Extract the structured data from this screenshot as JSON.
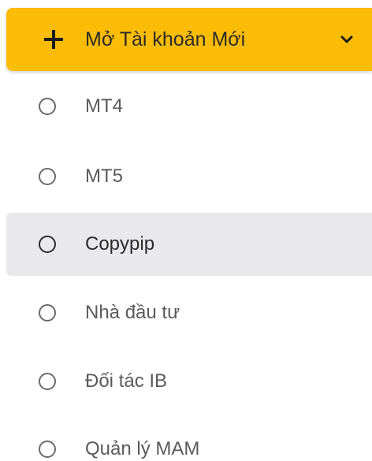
{
  "header": {
    "title": "Mở Tài khoản Mới",
    "icon": "plus-icon",
    "expand_icon": "chevron-down-icon",
    "color": "#fbbc05"
  },
  "items": [
    {
      "label": "MT4",
      "icon": "radio-icon",
      "active": false
    },
    {
      "label": "MT5",
      "icon": "radio-icon",
      "active": false
    },
    {
      "label": "Copypip",
      "icon": "radio-icon",
      "active": true
    },
    {
      "label": "Nhà đầu tư",
      "icon": "radio-icon",
      "active": false
    },
    {
      "label": "Đối tác IB",
      "icon": "radio-icon",
      "active": false
    },
    {
      "label": "Quản lý MAM",
      "icon": "radio-icon",
      "active": false
    }
  ],
  "colors": {
    "active_background": "#e9e9eb",
    "text": "#5b5b5b"
  }
}
